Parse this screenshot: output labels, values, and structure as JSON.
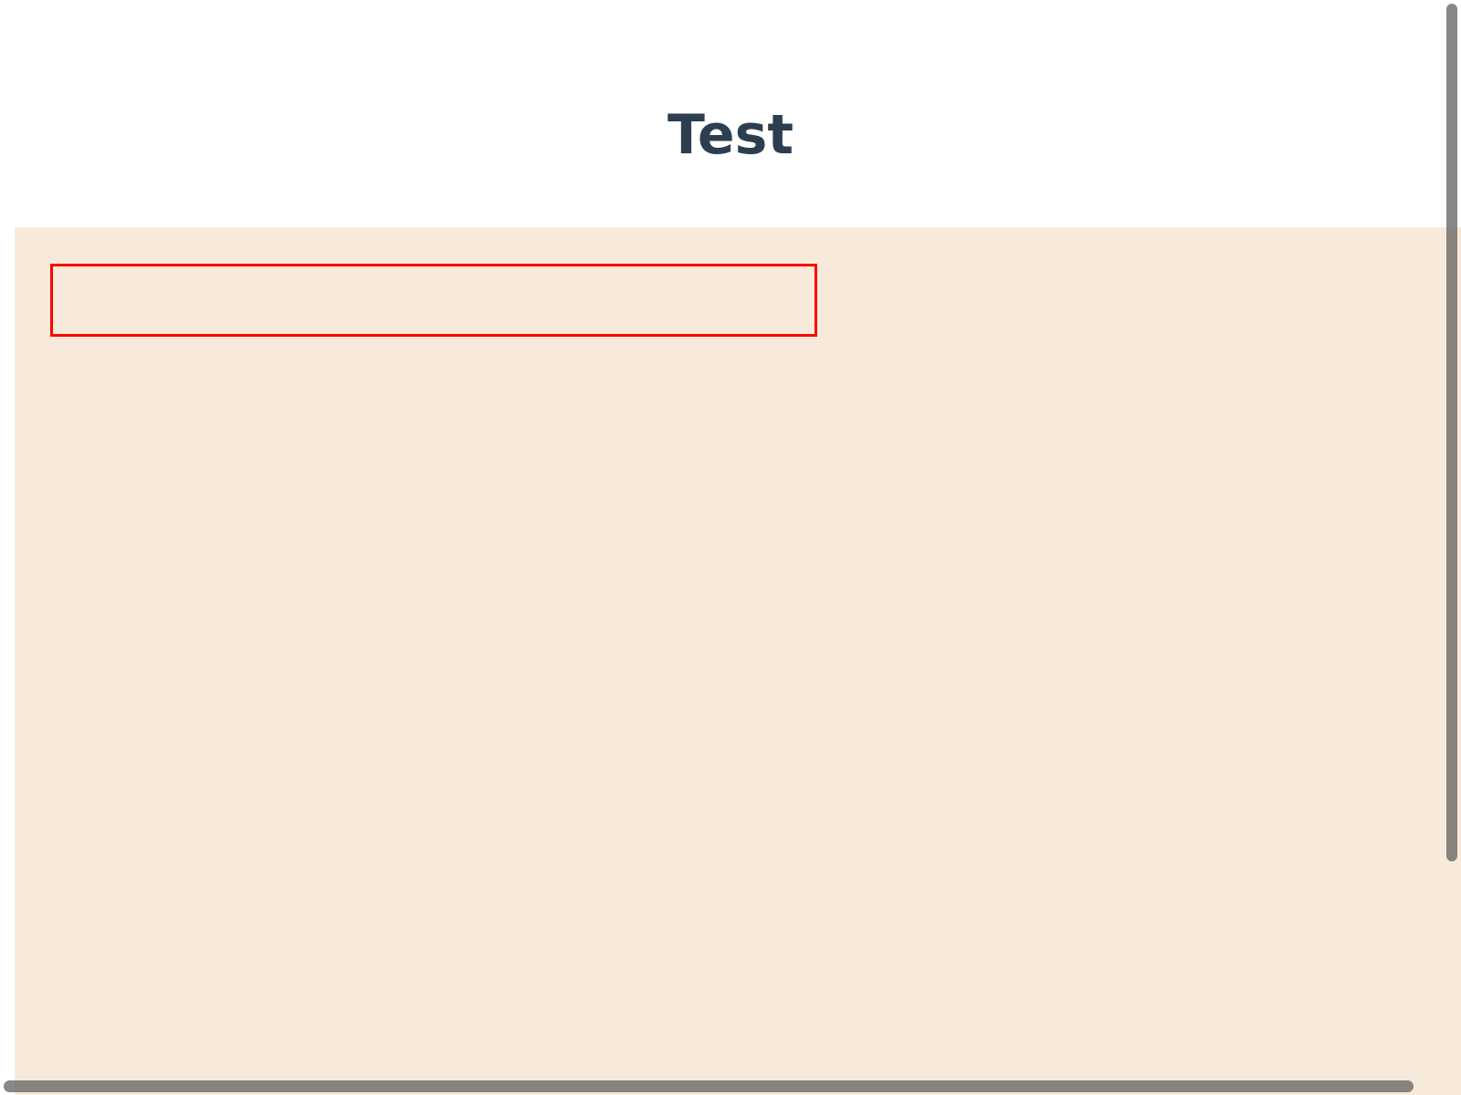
{
  "header": {
    "title": "Test"
  },
  "colors": {
    "title_text": "#2c3e50",
    "panel_background": "#f8eada",
    "box_border": "#ff0000",
    "scrollbar_thumb": "#5a5a5a"
  }
}
